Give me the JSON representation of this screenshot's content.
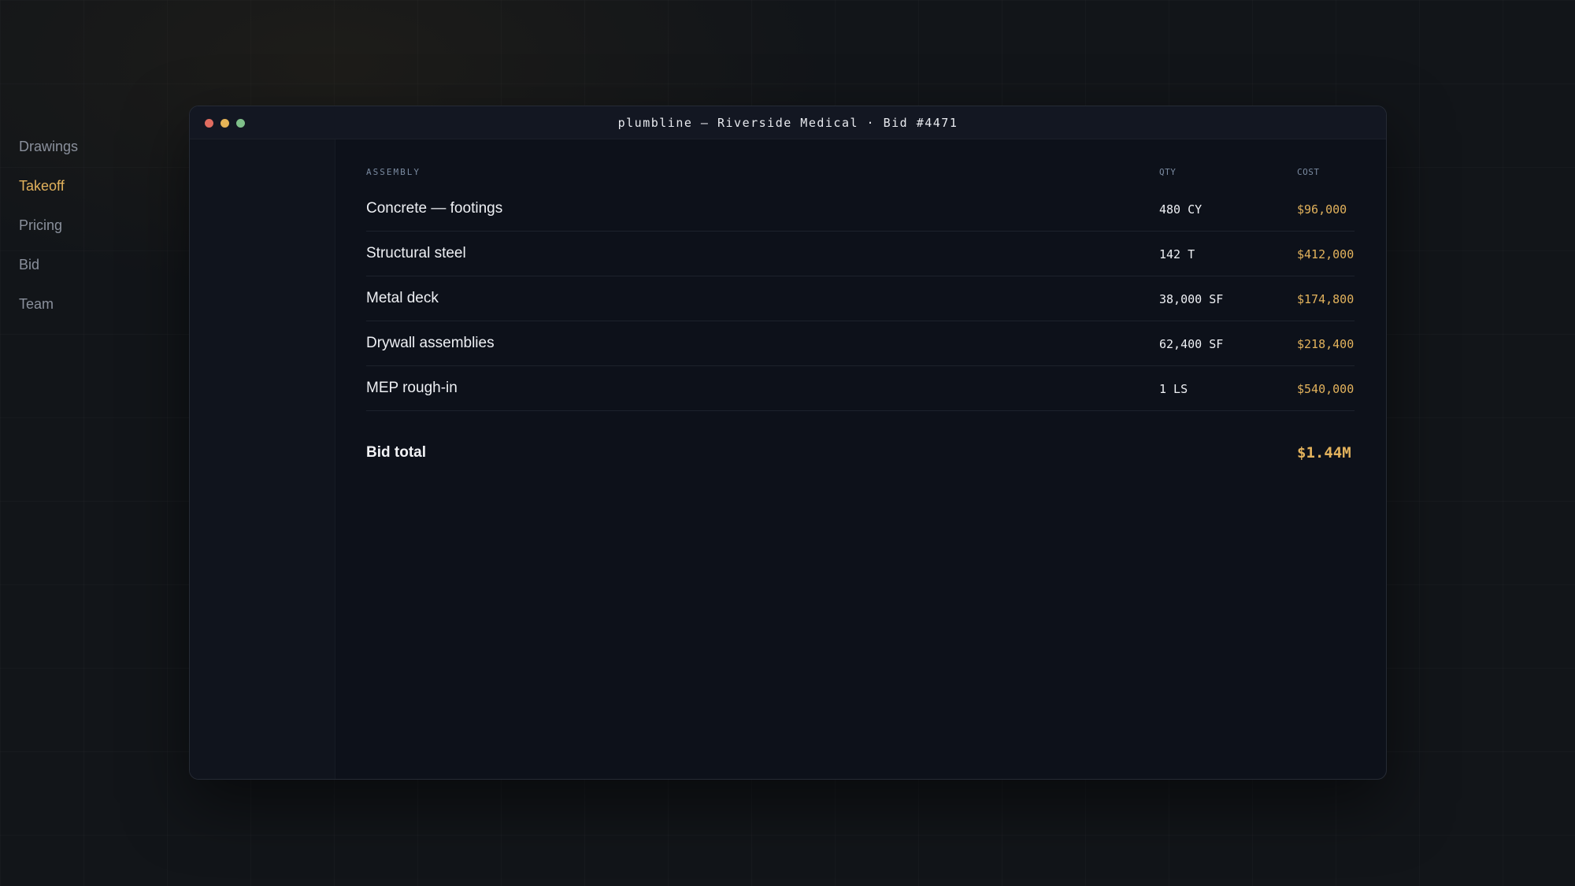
{
  "window": {
    "title": "plumbline — Riverside Medical · Bid #4471",
    "controls": [
      "close-dot",
      "minimize-dot",
      "maximize-dot"
    ]
  },
  "sidebar": {
    "active": "Takeoff",
    "items": [
      {
        "label": "Drawings"
      },
      {
        "label": "Takeoff"
      },
      {
        "label": "Pricing"
      },
      {
        "label": "Bid"
      },
      {
        "label": "Team"
      }
    ]
  },
  "table": {
    "headers": {
      "assembly": "ASSEMBLY",
      "qty": "QTY",
      "cost": "COST"
    },
    "rows": [
      {
        "assembly": "Concrete — footings",
        "qty": "480 CY",
        "cost": "$96,000"
      },
      {
        "assembly": "Structural steel",
        "qty": "142 T",
        "cost": "$412,000"
      },
      {
        "assembly": "Metal deck",
        "qty": "38,000 SF",
        "cost": "$174,800"
      },
      {
        "assembly": "Drywall assemblies",
        "qty": "62,400 SF",
        "cost": "$218,400"
      },
      {
        "assembly": "MEP rough-in",
        "qty": "1 LS",
        "cost": "$540,000"
      }
    ],
    "total": {
      "label": "Bid total",
      "value": "$1.44M"
    }
  },
  "colors": {
    "accent": "#e2b25c",
    "background": "#0d111a",
    "text": "#eef0f4",
    "muted": "#8a909c"
  }
}
